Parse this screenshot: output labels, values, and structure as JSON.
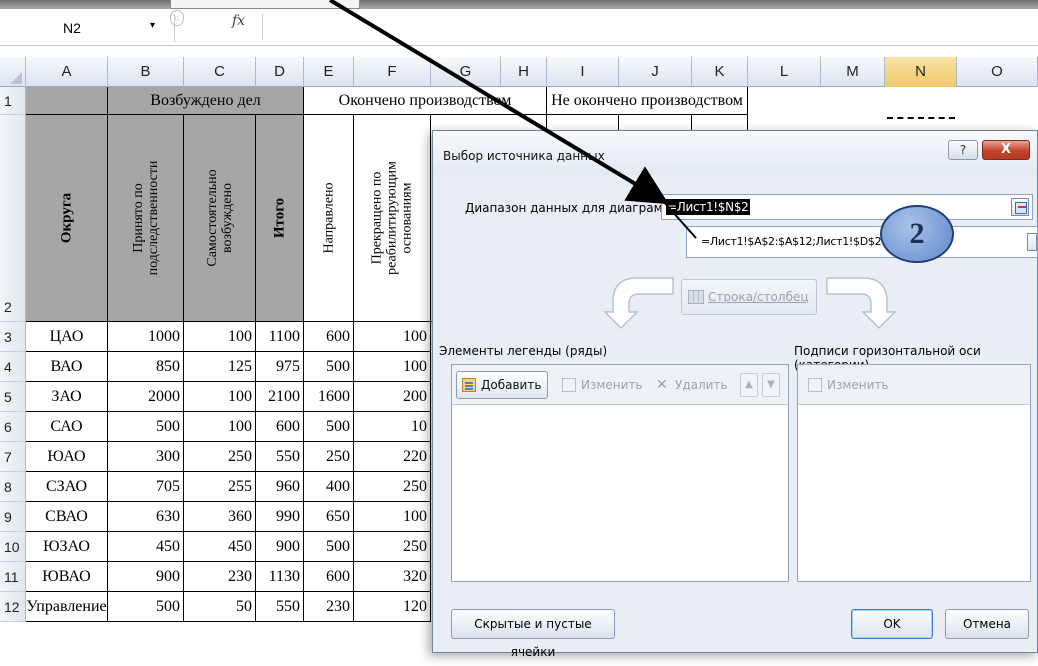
{
  "formula_bar": {
    "name_box": "N2",
    "dropdown_glyph": "▾",
    "cancel_glyph": "○",
    "fx_label": "fx"
  },
  "columns": [
    "A",
    "B",
    "C",
    "D",
    "E",
    "F",
    "G",
    "H",
    "I",
    "J",
    "K",
    "L",
    "M",
    "N",
    "O"
  ],
  "rows": [
    "1",
    "2",
    "3",
    "4",
    "5",
    "6",
    "7",
    "8",
    "9",
    "10",
    "11",
    "12"
  ],
  "sheet": {
    "group_headers": {
      "excited": "Возбуждено дел",
      "finished": "Окончено производством",
      "not_finished": "Не окончено производством"
    },
    "col_headers": {
      "district": "Округа",
      "accepted": "Принято по подследственности",
      "self_initiated": "Самостоятельно возбуждено",
      "total": "Итого",
      "directed": "Направлено",
      "terminated": "Прекращено по реабилитирующим основаниям"
    },
    "data_rows": [
      {
        "district": "ЦАО",
        "b": "1000",
        "c": "100",
        "d": "1100",
        "e": "600",
        "f": "100"
      },
      {
        "district": "ВАО",
        "b": "850",
        "c": "125",
        "d": "975",
        "e": "500",
        "f": "100"
      },
      {
        "district": "ЗАО",
        "b": "2000",
        "c": "100",
        "d": "2100",
        "e": "1600",
        "f": "200"
      },
      {
        "district": "САО",
        "b": "500",
        "c": "100",
        "d": "600",
        "e": "500",
        "f": "10"
      },
      {
        "district": "ЮАО",
        "b": "300",
        "c": "250",
        "d": "550",
        "e": "250",
        "f": "220"
      },
      {
        "district": "СЗАО",
        "b": "705",
        "c": "255",
        "d": "960",
        "e": "400",
        "f": "250"
      },
      {
        "district": "СВАО",
        "b": "630",
        "c": "360",
        "d": "990",
        "e": "650",
        "f": "100"
      },
      {
        "district": "ЮЗАО",
        "b": "450",
        "c": "450",
        "d": "900",
        "e": "500",
        "f": "250"
      },
      {
        "district": "ЮВАО",
        "b": "900",
        "c": "230",
        "d": "1130",
        "e": "600",
        "f": "320"
      },
      {
        "district": "Управление",
        "b": "500",
        "c": "50",
        "d": "550",
        "e": "230",
        "f": "120"
      }
    ]
  },
  "dialog": {
    "title": "Выбор источника данных",
    "help_glyph": "?",
    "close_glyph": "X",
    "range_label": "Диапазон данных для диаграммы:",
    "range_value": "=Лист1!$N$2",
    "tooltip_value": "=Лист1!$A$2:$A$12;Лист1!$D$2",
    "switch_label": "Строка/столбец",
    "legend_label": "Элементы легенды (ряды)",
    "axis_label": "Подписи горизонтальной оси (категории)",
    "add_label": "Добавить",
    "edit_label": "Изменить",
    "delete_label": "Удалить",
    "up_glyph": "▲",
    "down_glyph": "▼",
    "axis_edit_label": "Изменить",
    "hidden_cells_label": "Скрытые и пустые ячейки",
    "ok_label": "OK",
    "cancel_label": "Отмена"
  },
  "badge": {
    "number": "2"
  },
  "colors": {
    "header_gray": "#a6a6a6",
    "active_column": "#f0c969",
    "close_red": "#c2432c",
    "badge_blue": "#5f88c9"
  }
}
